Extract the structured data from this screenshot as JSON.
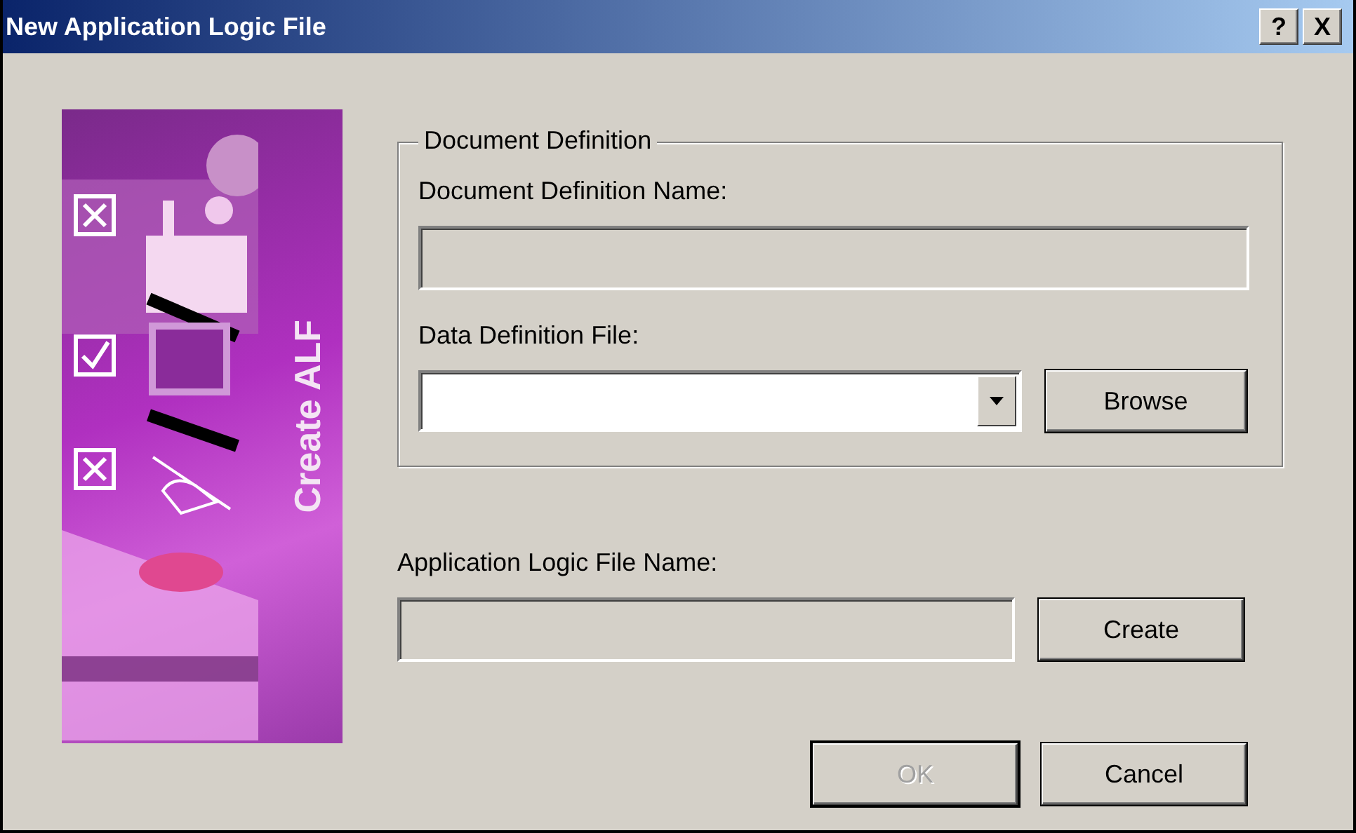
{
  "window": {
    "title": "New Application Logic File",
    "title_buttons": [
      "?",
      "X"
    ]
  },
  "banner": {
    "title": "Create ALF"
  },
  "document_definition": {
    "legend": "Document Definition",
    "name_label": "Document Definition Name:",
    "name_field": {
      "disabled": true
    },
    "file_label": "Data Definition File:",
    "file_combo": {
      "disabled": false
    },
    "browse_button": {
      "label": "Browse",
      "disabled": false
    }
  },
  "application_logic": {
    "label": "Application Logic File Name:",
    "field": {
      "disabled": true
    },
    "create_button": {
      "label": "Create",
      "disabled": false
    }
  },
  "buttons": [
    {
      "label": "OK",
      "disabled": true
    },
    {
      "label": "Cancel",
      "disabled": false
    }
  ]
}
